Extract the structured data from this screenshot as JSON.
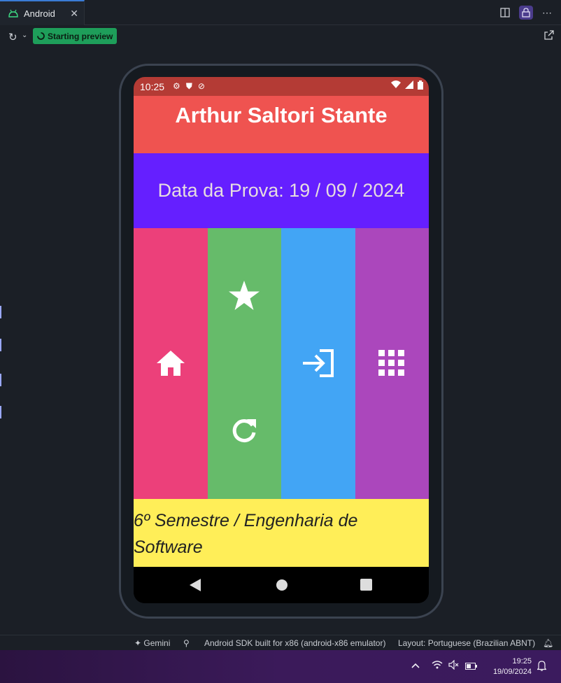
{
  "ide": {
    "tab_label": "Android",
    "tab_close": "✕",
    "preview_status": "Starting preview",
    "status_gemini": "Gemini",
    "status_device": "Android SDK built for x86 (android-x86 emulator)",
    "status_layout": "Layout: Portuguese (Brazilian ABNT)"
  },
  "phone": {
    "time": "10:25",
    "title": "Arthur Saltori Stante",
    "date_text": "Data da Prova: 19 / 09 / 2024",
    "footer_text": "6º Semestre / Engenharia de Software",
    "colors": {
      "status": "#b43b35",
      "title": "#ef5350",
      "date": "#651fff",
      "col1": "#ec407a",
      "col2": "#66bb6a",
      "col3": "#42a5f5",
      "col4": "#ab47bc",
      "footer": "#ffee58"
    },
    "icons": [
      "home-icon",
      "star-icon",
      "refresh-icon",
      "login-icon",
      "apps-icon"
    ]
  },
  "taskbar": {
    "time": "19:25",
    "date": "19/09/2024"
  }
}
